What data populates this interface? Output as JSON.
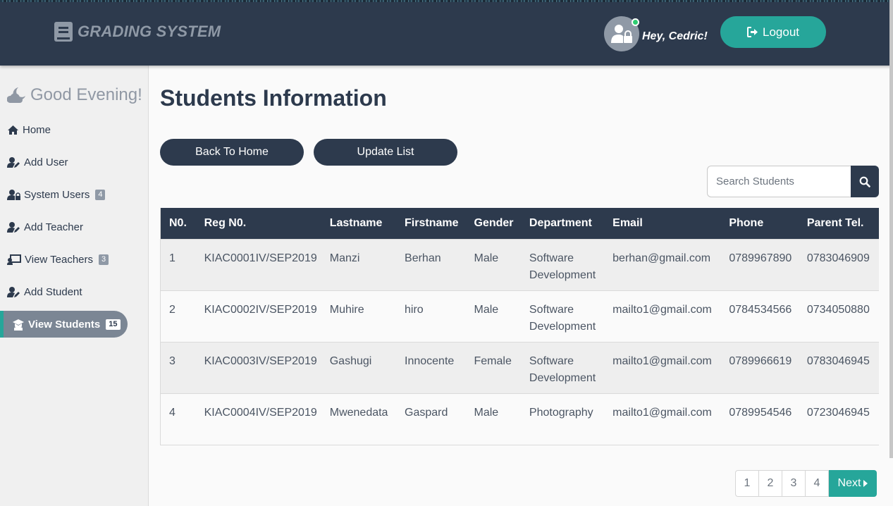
{
  "header": {
    "brand": "GRADING SYSTEM",
    "greeting": "Hey, Cedric!",
    "logout_label": "Logout"
  },
  "sidebar": {
    "greeting": "Good Evening!",
    "items": [
      {
        "label": "Home",
        "icon": "home-icon"
      },
      {
        "label": "Add User",
        "icon": "user-edit-icon"
      },
      {
        "label": "System Users",
        "badge": "4",
        "icon": "user-lock-icon"
      },
      {
        "label": "Add Teacher",
        "icon": "user-edit-icon"
      },
      {
        "label": "View Teachers",
        "badge": "3",
        "icon": "chalkboard-teacher-icon"
      },
      {
        "label": "Add Student",
        "icon": "user-edit-icon"
      },
      {
        "label": "View Students",
        "badge": "15",
        "icon": "graduate-icon",
        "active": true
      }
    ]
  },
  "main": {
    "title": "Students Information",
    "back_label": "Back To Home",
    "update_label": "Update List",
    "search_placeholder": "Search Students"
  },
  "table": {
    "columns": [
      "N0.",
      "Reg N0.",
      "Lastname",
      "Firstname",
      "Gender",
      "Department",
      "Email",
      "Phone",
      "Parent Tel."
    ],
    "rows": [
      [
        "1",
        "KIAC0001IV/SEP2019",
        "Manzi",
        "Berhan",
        "Male",
        "Software Development",
        "berhan@gmail.com",
        "0789967890",
        "0783046909"
      ],
      [
        "2",
        "KIAC0002IV/SEP2019",
        "Muhire",
        "hiro",
        "Male",
        "Software Development",
        "mailto1@gmail.com",
        "0784534566",
        "0734050880"
      ],
      [
        "3",
        "KIAC0003IV/SEP2019",
        "Gashugi",
        "Innocente",
        "Female",
        "Software Development",
        "mailto1@gmail.com",
        "0789966619",
        "0783046945"
      ],
      [
        "4",
        "KIAC0004IV/SEP2019",
        "Mwenedata",
        "Gaspard",
        "Male",
        "Photography",
        "mailto1@gmail.com",
        "0789954546",
        "0723046945"
      ]
    ]
  },
  "pagination": {
    "pages": [
      "1",
      "2",
      "3",
      "4"
    ],
    "next_label": "Next"
  },
  "colors": {
    "primary_dark": "#2d3a4d",
    "accent": "#26a69a"
  }
}
